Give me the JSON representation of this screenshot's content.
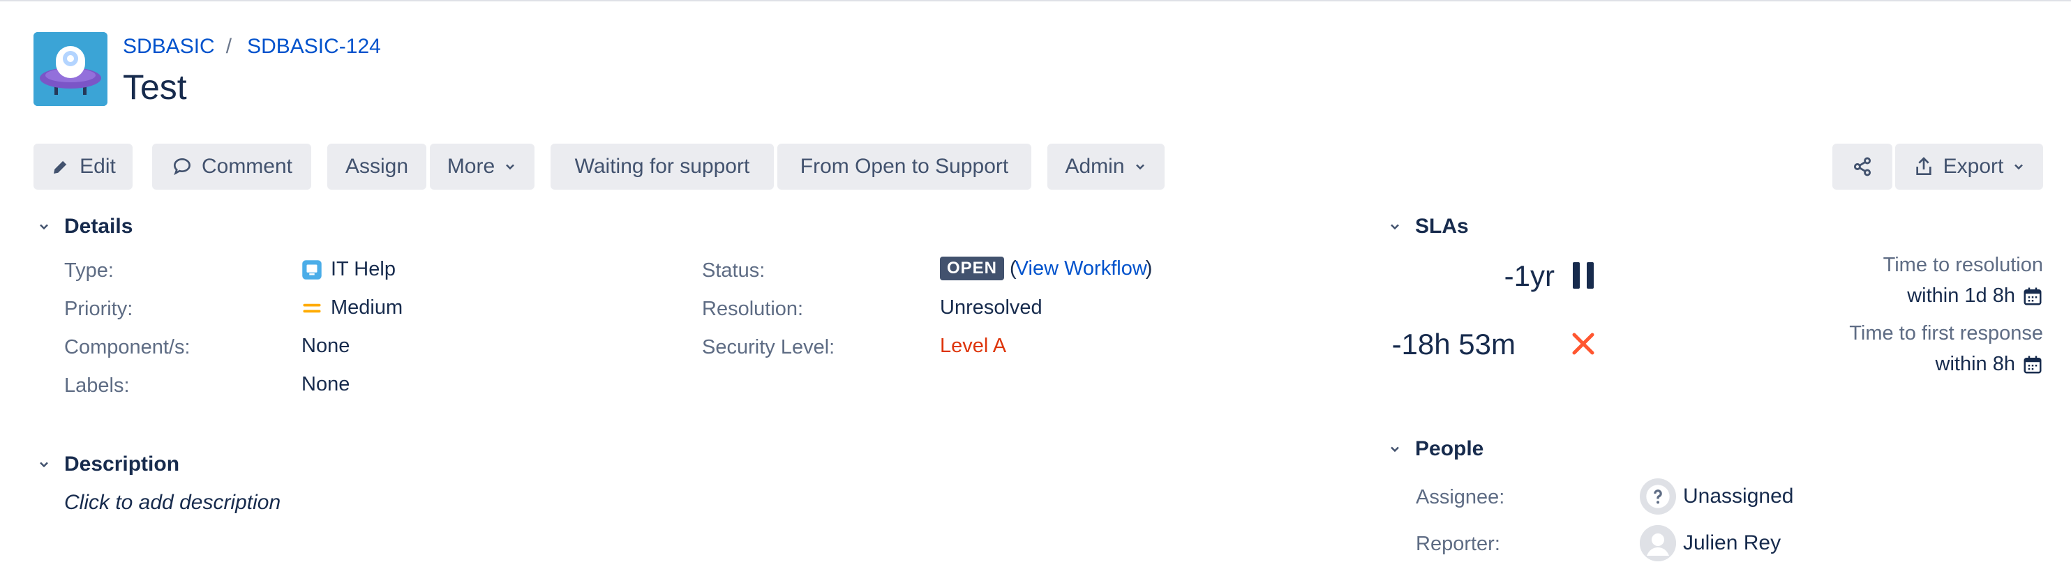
{
  "breadcrumb": {
    "project": "SDBASIC",
    "separator": "/",
    "issue_key": "SDBASIC-124"
  },
  "issue": {
    "title": "Test"
  },
  "toolbar": {
    "edit": "Edit",
    "comment": "Comment",
    "assign": "Assign",
    "more": "More",
    "waiting": "Waiting for support",
    "from_open": "From Open to Support",
    "admin": "Admin",
    "export": "Export"
  },
  "details": {
    "heading": "Details",
    "type_label": "Type:",
    "type_value": "IT Help",
    "priority_label": "Priority:",
    "priority_value": "Medium",
    "component_label": "Component/s:",
    "component_value": "None",
    "labels_label": "Labels:",
    "labels_value": "None",
    "status_label": "Status:",
    "status_value": "OPEN",
    "workflow_open": "(",
    "workflow_link": "View Workflow",
    "workflow_close": ")",
    "resolution_label": "Resolution:",
    "resolution_value": "Unresolved",
    "security_label": "Security Level:",
    "security_value": "Level A"
  },
  "description": {
    "heading": "Description",
    "placeholder": "Click to add description"
  },
  "slas": {
    "heading": "SLAs",
    "items": [
      {
        "remaining": "-1yr",
        "state_icon": "pause-icon",
        "name": "Time to resolution",
        "goal": "within 1d 8h"
      },
      {
        "remaining": "-18h 53m",
        "state_icon": "breached-x-icon",
        "name": "Time to first response",
        "goal": "within 8h"
      }
    ]
  },
  "people": {
    "heading": "People",
    "assignee_label": "Assignee:",
    "assignee_value": "Unassigned",
    "reporter_label": "Reporter:",
    "reporter_value": "Julien Rey"
  },
  "colors": {
    "link": "#0052cc",
    "button_bg": "#ebecf0",
    "lozenge": "#42526e",
    "security": "#de350b",
    "breach": "#ff5630",
    "priority_medium": "#ffab00"
  }
}
